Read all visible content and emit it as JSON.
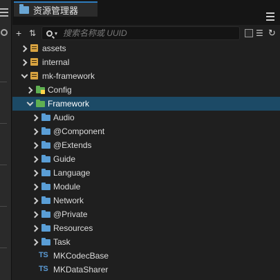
{
  "panel": {
    "tab_title": "资源管理器"
  },
  "toolbar": {
    "add_icon": "plus-icon",
    "sort_icon": "sort-icon",
    "search_placeholder": "搜索名称或 UUID",
    "checkbox_checked": false,
    "collapse_icon": "collapse-tree-icon",
    "refresh_icon": "refresh-icon"
  },
  "tree": {
    "rows": [
      {
        "label": "assets",
        "icon": "database-icon",
        "expanded": false,
        "selected": false,
        "depth": 0
      },
      {
        "label": "internal",
        "icon": "database-icon",
        "expanded": false,
        "selected": false,
        "depth": 0
      },
      {
        "label": "mk-framework",
        "icon": "database-icon",
        "expanded": true,
        "selected": false,
        "depth": 0
      },
      {
        "label": "Config",
        "icon": "folder-bundle-icon",
        "expanded": false,
        "selected": false,
        "depth": 1
      },
      {
        "label": "Framework",
        "icon": "folder-open-icon",
        "expanded": true,
        "selected": true,
        "depth": 1
      },
      {
        "label": "Audio",
        "icon": "folder-icon",
        "expanded": false,
        "selected": false,
        "depth": 2
      },
      {
        "label": "@Component",
        "icon": "folder-icon",
        "expanded": false,
        "selected": false,
        "depth": 2
      },
      {
        "label": "@Extends",
        "icon": "folder-icon",
        "expanded": false,
        "selected": false,
        "depth": 2
      },
      {
        "label": "Guide",
        "icon": "folder-icon",
        "expanded": false,
        "selected": false,
        "depth": 2
      },
      {
        "label": "Language",
        "icon": "folder-icon",
        "expanded": false,
        "selected": false,
        "depth": 2
      },
      {
        "label": "Module",
        "icon": "folder-icon",
        "expanded": false,
        "selected": false,
        "depth": 2
      },
      {
        "label": "Network",
        "icon": "folder-icon",
        "expanded": false,
        "selected": false,
        "depth": 2
      },
      {
        "label": "@Private",
        "icon": "folder-icon",
        "expanded": false,
        "selected": false,
        "depth": 2
      },
      {
        "label": "Resources",
        "icon": "folder-icon",
        "expanded": false,
        "selected": false,
        "depth": 2
      },
      {
        "label": "Task",
        "icon": "folder-icon",
        "expanded": false,
        "selected": false,
        "depth": 2
      },
      {
        "label": "MKCodecBase",
        "icon": "typescript-file-icon",
        "file_type": "TS",
        "selected": false,
        "depth": 2
      },
      {
        "label": "MKDataSharer",
        "icon": "typescript-file-icon",
        "file_type": "TS",
        "selected": false,
        "depth": 2
      }
    ]
  },
  "colors": {
    "selection": "#1c4a66",
    "folder": "#5a9ed6",
    "database": "#d9a441",
    "bundle_folder": "#5fb052",
    "ts_badge": "#5b9bd5"
  }
}
